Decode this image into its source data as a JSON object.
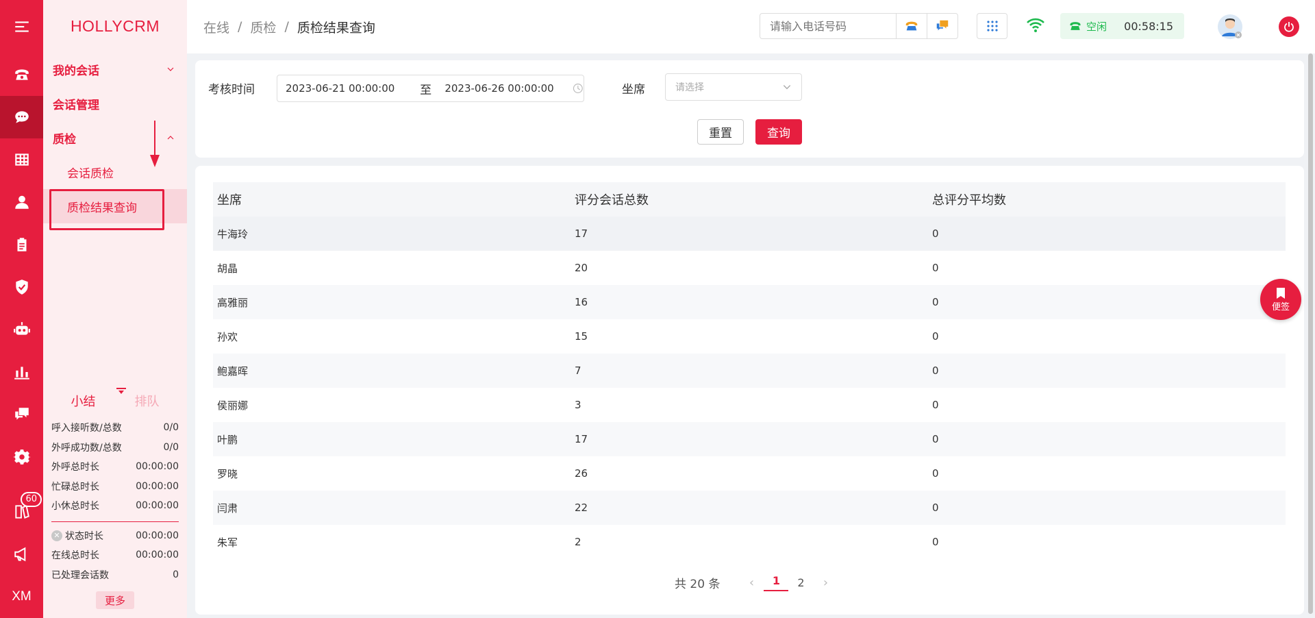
{
  "brand": "HOLLYCRM",
  "rail": {
    "icons": [
      "menu-icon",
      "phone-icon",
      "chat-icon",
      "grid-table-icon",
      "user-icon",
      "clipboard-icon",
      "shield-icon",
      "robot-icon",
      "bar-chart-icon",
      "message-icon",
      "gear-icon",
      "book-icon",
      "megaphone-icon"
    ],
    "badge": "60",
    "bottom_text": "XM"
  },
  "sidebar": {
    "groups": [
      {
        "label": "我的会话"
      },
      {
        "label": "会话管理"
      },
      {
        "label": "质检"
      }
    ],
    "subitems": [
      {
        "label": "会话质检"
      },
      {
        "label": "质检结果查询"
      }
    ]
  },
  "stats": {
    "tabs": [
      "小结",
      "排队"
    ],
    "rows": [
      {
        "label": "呼入接听数/总数",
        "value": "0/0"
      },
      {
        "label": "外呼成功数/总数",
        "value": "0/0"
      },
      {
        "label": "外呼总时长",
        "value": "00:00:00"
      },
      {
        "label": "忙碌总时长",
        "value": "00:00:00"
      },
      {
        "label": "小休总时长",
        "value": "00:00:00"
      }
    ],
    "rows2": [
      {
        "label": "状态时长",
        "value": "00:00:00"
      },
      {
        "label": "在线总时长",
        "value": "00:00:00"
      },
      {
        "label": "已处理会话数",
        "value": "0"
      }
    ],
    "more": "更多"
  },
  "header": {
    "breadcrumb": [
      "在线",
      "质检",
      "质检结果查询"
    ],
    "phone_placeholder": "请输入电话号码",
    "status": "空闲",
    "duration": "00:58:15"
  },
  "filter": {
    "time_label": "考核时间",
    "start": "2023-06-21 00:00:00",
    "to": "至",
    "end": "2023-06-26 00:00:00",
    "agent_label": "坐席",
    "agent_placeholder": "请选择",
    "reset": "重置",
    "search": "查询"
  },
  "table": {
    "columns": [
      "坐席",
      "评分会话总数",
      "总评分平均数"
    ],
    "rows": [
      [
        "牛海玲",
        "17",
        "0"
      ],
      [
        "胡晶",
        "20",
        "0"
      ],
      [
        "高雅丽",
        "16",
        "0"
      ],
      [
        "孙欢",
        "15",
        "0"
      ],
      [
        "鲍嘉晖",
        "7",
        "0"
      ],
      [
        "侯丽娜",
        "3",
        "0"
      ],
      [
        "叶鹏",
        "17",
        "0"
      ],
      [
        "罗晓",
        "26",
        "0"
      ],
      [
        "闫肃",
        "22",
        "0"
      ],
      [
        "朱军",
        "2",
        "0"
      ]
    ]
  },
  "pager": {
    "total": "共 20 条",
    "pages": [
      "1",
      "2"
    ],
    "current": "1"
  },
  "note_button": "便签",
  "colors": {
    "accent": "#e61e3f",
    "status_green": "#1fba4f"
  }
}
